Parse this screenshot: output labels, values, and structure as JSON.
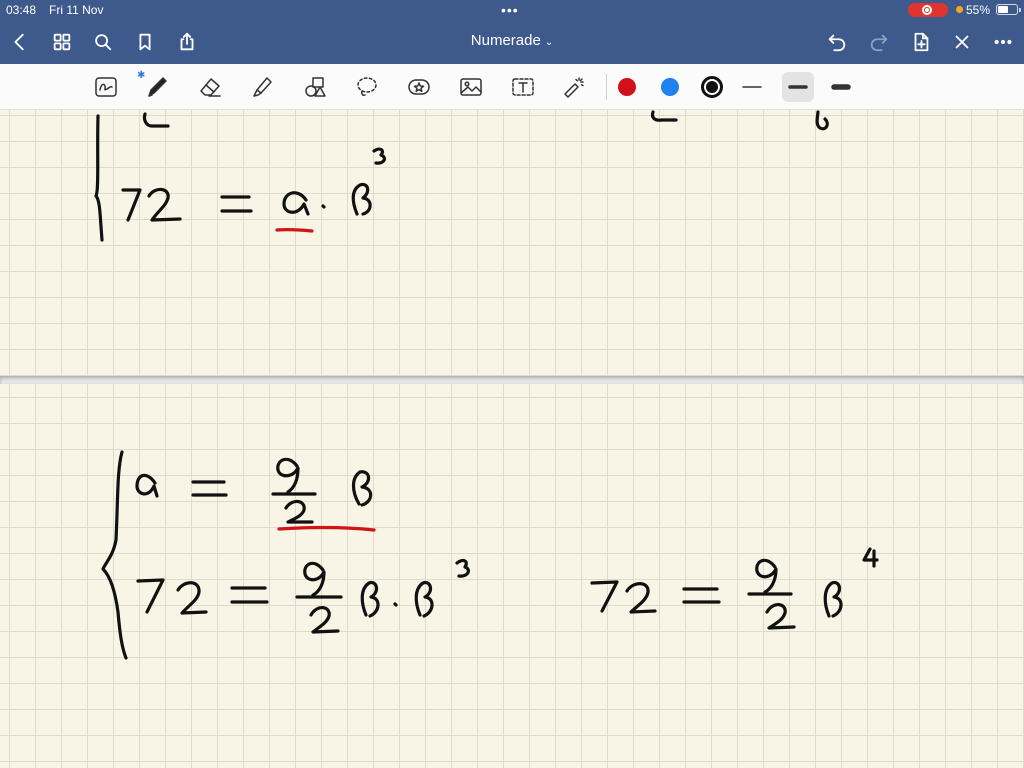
{
  "status_bar": {
    "time": "03:48",
    "date": "Fri 11 Nov",
    "multitask_dots": "•••",
    "battery_percent": "55%",
    "battery_level": 0.55,
    "recording_color": "#e0342f"
  },
  "nav_bar": {
    "title": "Numerade",
    "title_chevron": "⌄",
    "background_color": "#3e5a8c",
    "left_icons": [
      "back-icon",
      "grid-icon",
      "search-icon",
      "bookmark-icon",
      "share-icon"
    ],
    "right_icons": [
      "undo-icon",
      "redo-icon",
      "add-page-icon",
      "close-icon",
      "more-icon"
    ]
  },
  "toolbar": {
    "tools": [
      "lasso-read-icon",
      "pen-icon",
      "eraser-icon",
      "highlighter-icon",
      "shapes-icon",
      "lasso-icon",
      "sticker-icon",
      "image-icon",
      "text-icon",
      "laser-icon"
    ],
    "selected_tool": "pen-icon",
    "colors": [
      {
        "name": "red",
        "hex": "#d0111b"
      },
      {
        "name": "blue",
        "hex": "#1e83f0"
      },
      {
        "name": "black",
        "hex": "#111111",
        "selected": true
      }
    ],
    "stroke_widths": [
      "thin",
      "medium",
      "thick"
    ],
    "selected_width": "medium"
  },
  "document": {
    "paper": "grid",
    "paper_color": "#f8f5e6",
    "ink_colors": {
      "black": "#111111",
      "red": "#d01515"
    }
  }
}
